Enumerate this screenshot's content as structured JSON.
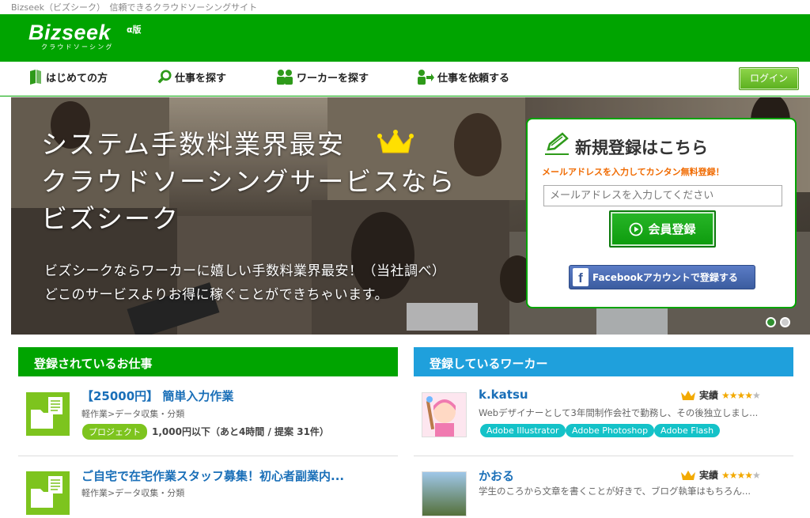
{
  "browser_title": "Bizseek（ビズシーク）　信頼できるクラウドソーシングサイト",
  "logo": {
    "main": "Bizseek",
    "alpha": "α版",
    "sub": "クラウドソーシング"
  },
  "nav": {
    "items": [
      {
        "label": "はじめての方",
        "icon": "book-icon"
      },
      {
        "label": "仕事を探す",
        "icon": "magnifier-icon"
      },
      {
        "label": "ワーカーを探す",
        "icon": "people-icon"
      },
      {
        "label": "仕事を依頼する",
        "icon": "person-arrow-icon"
      }
    ],
    "login": "ログイン"
  },
  "hero": {
    "title_lines": [
      "システム手数料業界最安",
      "クラウドソーシングサービスなら",
      "ビズシーク"
    ],
    "sub_lines": [
      "ビズシークならワーカーに嬉しい手数料業界最安！（当社調べ）",
      "どこのサービスよりお得に稼ぐことができちゃいます。"
    ]
  },
  "register": {
    "title": "新規登録はこちら",
    "note": "メールアドレスを入力してカンタン無料登録！",
    "placeholder": "メールアドレスを入力してください",
    "button": "会員登録",
    "facebook": "Facebookアカウントで登録する"
  },
  "jobs": {
    "heading": "登録されているお仕事",
    "items": [
      {
        "title": "【25000円】 簡単入力作業",
        "category": "軽作業>データ収集・分類",
        "badge": "プロジェクト",
        "meta": "1,000円以下（あと4時間 / 提案 31件）"
      },
      {
        "title": "ご自宅で在宅作業スタッフ募集！初心者副業内...",
        "category": "軽作業>データ収集・分類"
      }
    ]
  },
  "workers": {
    "heading": "登録しているワーカー",
    "items": [
      {
        "name": "k.katsu",
        "rating_label": "実績",
        "rating": 4,
        "description": "Webデザイナーとして3年間制作会社で勤務し、その後独立しまし...",
        "skills": [
          "Adobe Illustrator",
          "Adobe Photoshop",
          "Adobe Flash"
        ]
      },
      {
        "name": "かおる",
        "rating_label": "実績",
        "rating": 4,
        "description": "学生のころから文章を書くことが好きで、ブログ執筆はもちろん..."
      }
    ]
  },
  "colors": {
    "brand_green": "#00a400",
    "worker_blue": "#1fa0dc",
    "link_blue": "#1a6fb8",
    "accent_orange": "#f06a00"
  }
}
